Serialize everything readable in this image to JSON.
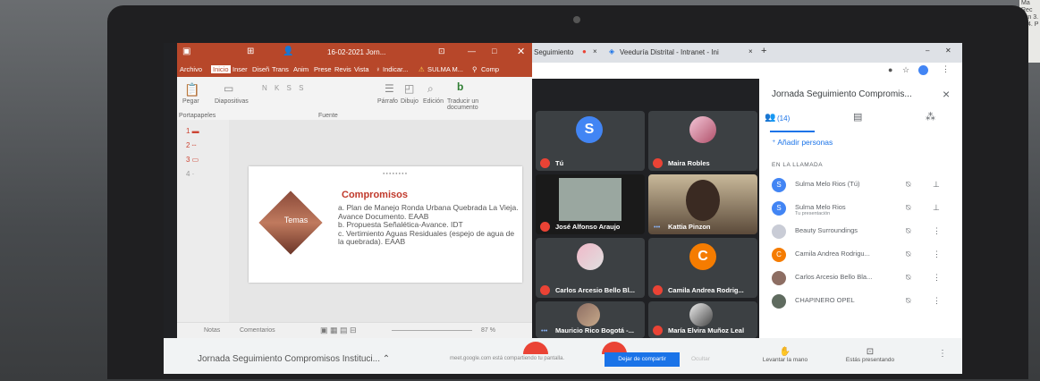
{
  "ppt": {
    "window_title": "16-02-2021 Jorn...",
    "ribbon_tabs": [
      "Archivo",
      "Inicio",
      "Inser",
      "Diseñ",
      "Trans",
      "Anim",
      "Prese",
      "Revis",
      "Vista",
      "Indicar...",
      "SULMA M...",
      "Comp"
    ],
    "ribbon_labels": {
      "paste": "Pegar",
      "slides": "Diapositivas",
      "paragraph": "Párrafo",
      "drawing": "Dibujo",
      "editing": "Edición",
      "translate": "Traducir un documento",
      "clipboard": "Portapapeles",
      "font": "Fuente"
    },
    "thumbnails": [
      "1",
      "2",
      "3",
      "4"
    ],
    "slide": {
      "tema_label": "Temas",
      "heading": "Compromisos",
      "items": [
        "a. Plan de Manejo Ronda Urbana Quebrada La Vieja. Avance Documento. EAAB",
        "b. Propuesta Señalética-Avance. IDT",
        "c. Vertimiento Aguas Residuales (espejo de agua de la quebrada). EAAB"
      ]
    },
    "status": {
      "notes": "Notas",
      "comments": "Comentarios",
      "zoom": "87 %"
    }
  },
  "browser": {
    "tab1": "Seguimiento",
    "tab2": "Veeduría Distrital - Intranet - Ini"
  },
  "meet": {
    "tiles": [
      {
        "name": "Tú",
        "initial": "S",
        "color": "#4285f4"
      },
      {
        "name": "Maira Robles"
      },
      {
        "name": "José Alfonso Araujo"
      },
      {
        "name": "Kattia Pinzon"
      },
      {
        "name": "Carlos Arcesio Bello Bl..."
      },
      {
        "name": "Camila Andrea Rodrig...",
        "initial": "C",
        "color": "#f57c00"
      },
      {
        "name": "Mauricio Rico Bogotá -..."
      },
      {
        "name": "María Elvira Muñoz Leal"
      }
    ],
    "panel": {
      "title": "Jornada Seguimiento Compromis...",
      "count": "(14)",
      "add_people": "Añadir personas",
      "section": "EN LA LLAMADA",
      "people": [
        {
          "name": "Sulma Melo Rios (Tú)",
          "initial": "S",
          "color": "#4285f4",
          "sub": ""
        },
        {
          "name": "Sulma Melo Rios",
          "initial": "S",
          "color": "#4285f4",
          "sub": "Tu presentación"
        },
        {
          "name": "Beauty Surroundings",
          "initial": "",
          "color": "#c9ccd6",
          "sub": ""
        },
        {
          "name": "Camila Andrea Rodrigu...",
          "initial": "C",
          "color": "#f57c00",
          "sub": ""
        },
        {
          "name": "Carlos Arcesio Bello Bla...",
          "initial": "",
          "color": "#8d6e63",
          "sub": ""
        },
        {
          "name": "CHAPINERO OPEL",
          "initial": "",
          "color": "#5f6b5f",
          "sub": ""
        }
      ]
    },
    "bottom": {
      "meeting_name": "Jornada Seguimiento Compromisos Instituci...",
      "share_text": "meet.google.com está compartiendo tu pantalla.",
      "stop_share": "Dejar de compartir",
      "hide": "Ocultar",
      "raise_hand": "Levantar la mano",
      "presenting": "Estás presentando"
    }
  },
  "paper_note": "Ma Rec ven 3. R 4. P"
}
